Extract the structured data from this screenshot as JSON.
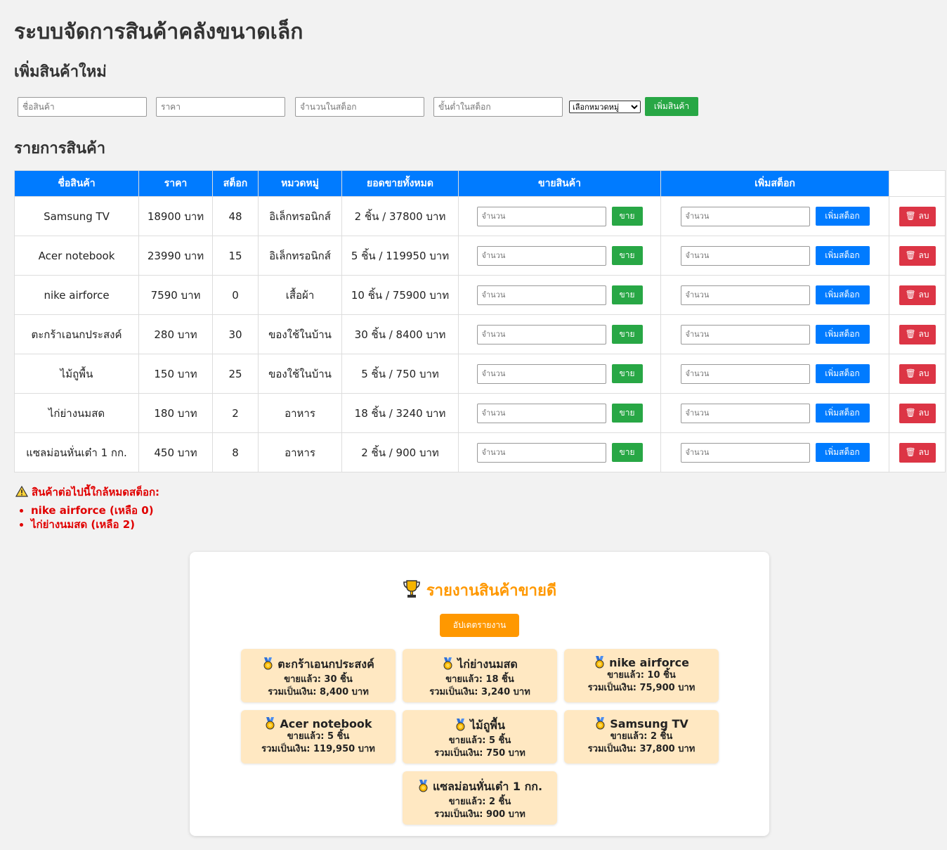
{
  "page_title": "ระบบจัดการสินค้าคลังขนาดเล็ก",
  "add_section": {
    "heading": "เพิ่มสินค้าใหม่",
    "name_placeholder": "ชื่อสินค้า",
    "price_placeholder": "ราคา",
    "stock_placeholder": "จำนวนในสต็อก",
    "min_stock_placeholder": "ขั้นต่ำในสต็อก",
    "category_select": "เลือกหมวดหมู่",
    "add_button": "เพิ่มสินค้า"
  },
  "list_section": {
    "heading": "รายการสินค้า",
    "columns": [
      "ชื่อสินค้า",
      "ราคา",
      "สต็อก",
      "หมวดหมู่",
      "ยอดขายทั้งหมด",
      "ขายสินค้า",
      "เพิ่มสต็อก"
    ],
    "qty_placeholder": "จำนวน",
    "sell_label": "ขาย",
    "restock_label": "เพิ่มสต็อก",
    "delete_label": "🗑 ลบ",
    "rows": [
      {
        "name": "Samsung TV",
        "price": "18900 บาท",
        "stock": "48",
        "category": "อิเล็กทรอนิกส์",
        "sales": "2 ชิ้น / 37800 บาท"
      },
      {
        "name": "Acer notebook",
        "price": "23990 บาท",
        "stock": "15",
        "category": "อิเล็กทรอนิกส์",
        "sales": "5 ชิ้น / 119950 บาท"
      },
      {
        "name": "nike airforce",
        "price": "7590 บาท",
        "stock": "0",
        "category": "เสื้อผ้า",
        "sales": "10 ชิ้น / 75900 บาท"
      },
      {
        "name": "ตะกร้าเอนกประสงค์",
        "price": "280 บาท",
        "stock": "30",
        "category": "ของใช้ในบ้าน",
        "sales": "30 ชิ้น / 8400 บาท"
      },
      {
        "name": "ไม้ถูพื้น",
        "price": "150 บาท",
        "stock": "25",
        "category": "ของใช้ในบ้าน",
        "sales": "5 ชิ้น / 750 บาท"
      },
      {
        "name": "ไก่ย่างนมสด",
        "price": "180 บาท",
        "stock": "2",
        "category": "อาหาร",
        "sales": "18 ชิ้น / 3240 บาท"
      },
      {
        "name": "แซลม่อนหั่นเต๋า 1 กก.",
        "price": "450 บาท",
        "stock": "8",
        "category": "อาหาร",
        "sales": "2 ชิ้น / 900 บาท"
      }
    ]
  },
  "low_stock": {
    "icon": "warning-icon",
    "title": "สินค้าต่อไปนี้ใกล้หมดสต็อก:",
    "items": [
      "nike airforce (เหลือ 0)",
      "ไก่ย่างนมสด (เหลือ 2)"
    ]
  },
  "report": {
    "icon": "trophy-icon",
    "title": "รายงานสินค้าขายดี",
    "update_button": "อัปเดตรายงาน",
    "items": [
      {
        "name": "ตะกร้าเอนกประสงค์",
        "sold": "ขายแล้ว: 30 ชิ้น",
        "total": "รวมเป็นเงิน: 8,400 บาท"
      },
      {
        "name": "ไก่ย่างนมสด",
        "sold": "ขายแล้ว: 18 ชิ้น",
        "total": "รวมเป็นเงิน: 3,240 บาท"
      },
      {
        "name": "nike airforce",
        "sold": "ขายแล้ว: 10 ชิ้น",
        "total": "รวมเป็นเงิน: 75,900 บาท"
      },
      {
        "name": "Acer notebook",
        "sold": "ขายแล้ว: 5 ชิ้น",
        "total": "รวมเป็นเงิน: 119,950 บาท"
      },
      {
        "name": "ไม้ถูพื้น",
        "sold": "ขายแล้ว: 5 ชิ้น",
        "total": "รวมเป็นเงิน: 750 บาท"
      },
      {
        "name": "Samsung TV",
        "sold": "ขายแล้ว: 2 ชิ้น",
        "total": "รวมเป็นเงิน: 37,800 บาท"
      },
      {
        "name": "แซลม่อนหั่นเต๋า 1 กก.",
        "sold": "ขายแล้ว: 2 ชิ้น",
        "total": "รวมเป็นเงิน: 900 บาท"
      }
    ]
  },
  "colors": {
    "primary": "#007bff",
    "success": "#28a745",
    "danger": "#dc3545",
    "warning": "#ff9800",
    "card_bg": "#ffe8c2",
    "alert_text": "#e00000"
  }
}
